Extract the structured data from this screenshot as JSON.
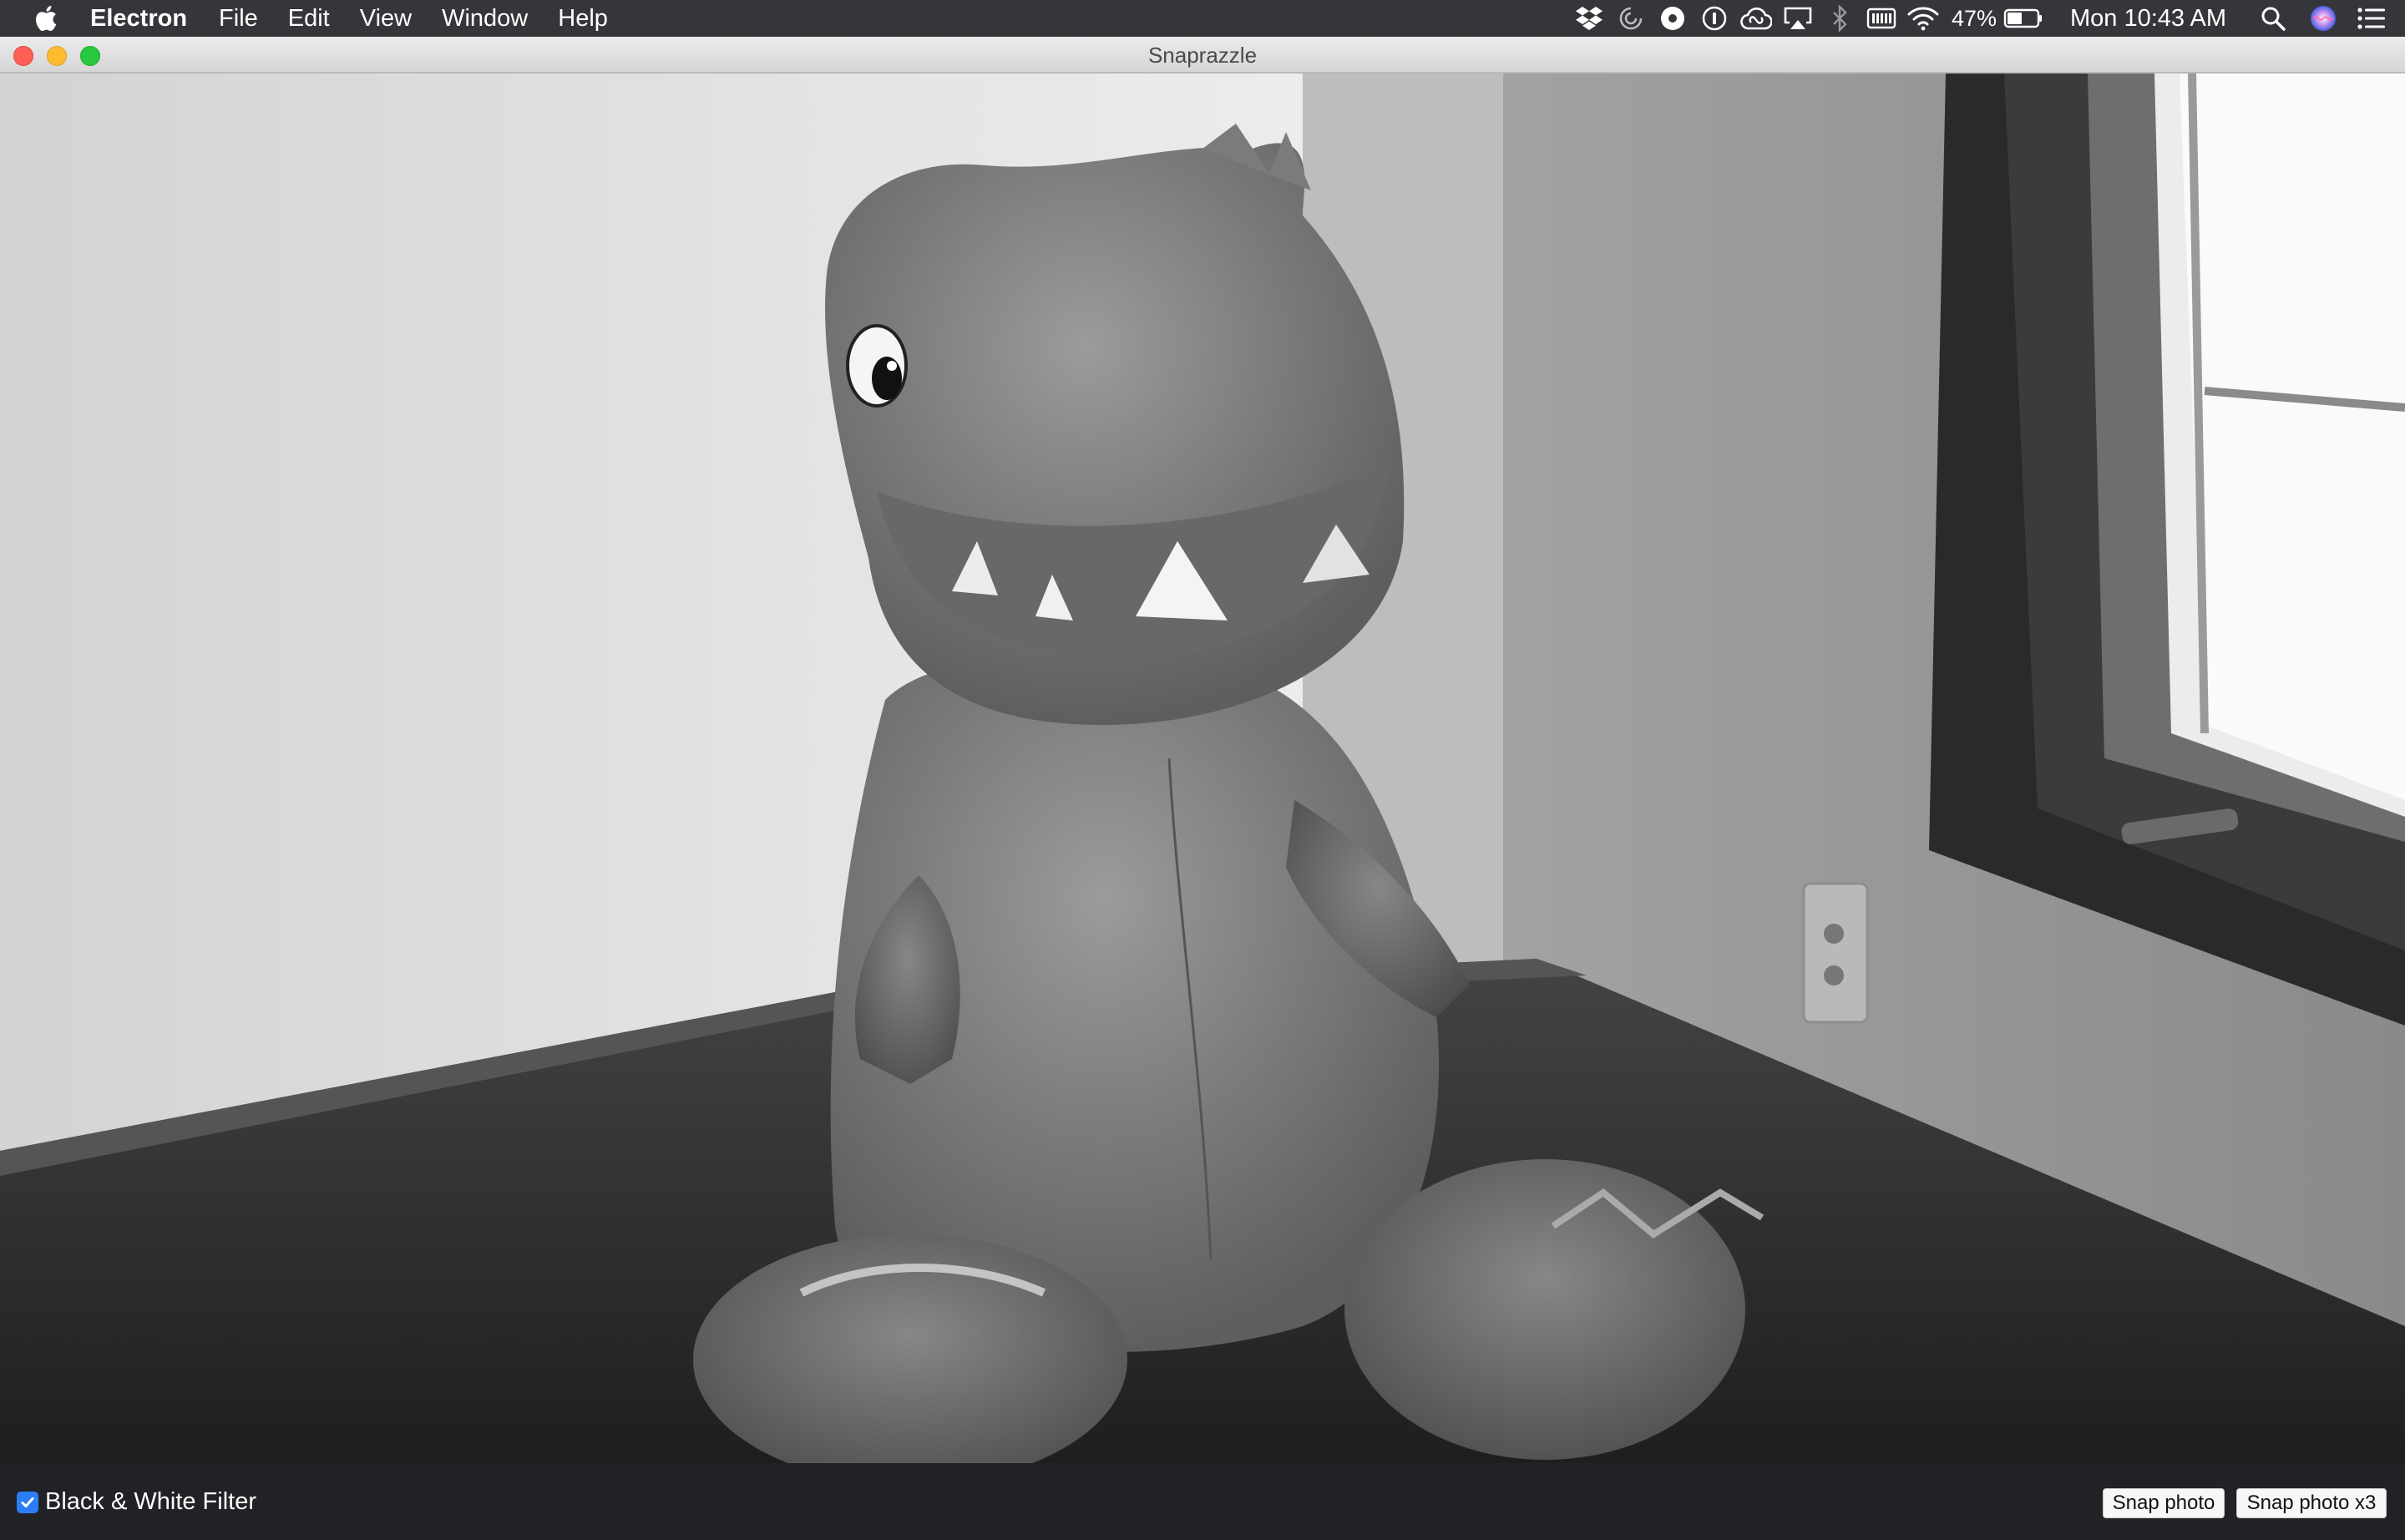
{
  "menubar": {
    "app_name": "Electron",
    "items": [
      "File",
      "Edit",
      "View",
      "Window",
      "Help"
    ],
    "tray": {
      "icons": [
        "dropbox-icon",
        "sync-icon",
        "disc-icon",
        "password-icon",
        "creative-cloud-icon",
        "airplay-icon",
        "bluetooth-icon",
        "keyboard-icon",
        "wifi-icon",
        "battery-icon",
        "search-icon",
        "siri-icon",
        "notification-list-icon"
      ],
      "battery_percent": "47%",
      "clock": "Mon 10:43 AM"
    }
  },
  "window": {
    "title": "Snaprazzle"
  },
  "controls": {
    "filter_label": "Black & White Filter",
    "filter_checked": true,
    "snap_label": "Snap photo",
    "snap3_label": "Snap photo x3",
    "accent": "#2c7ef7"
  }
}
